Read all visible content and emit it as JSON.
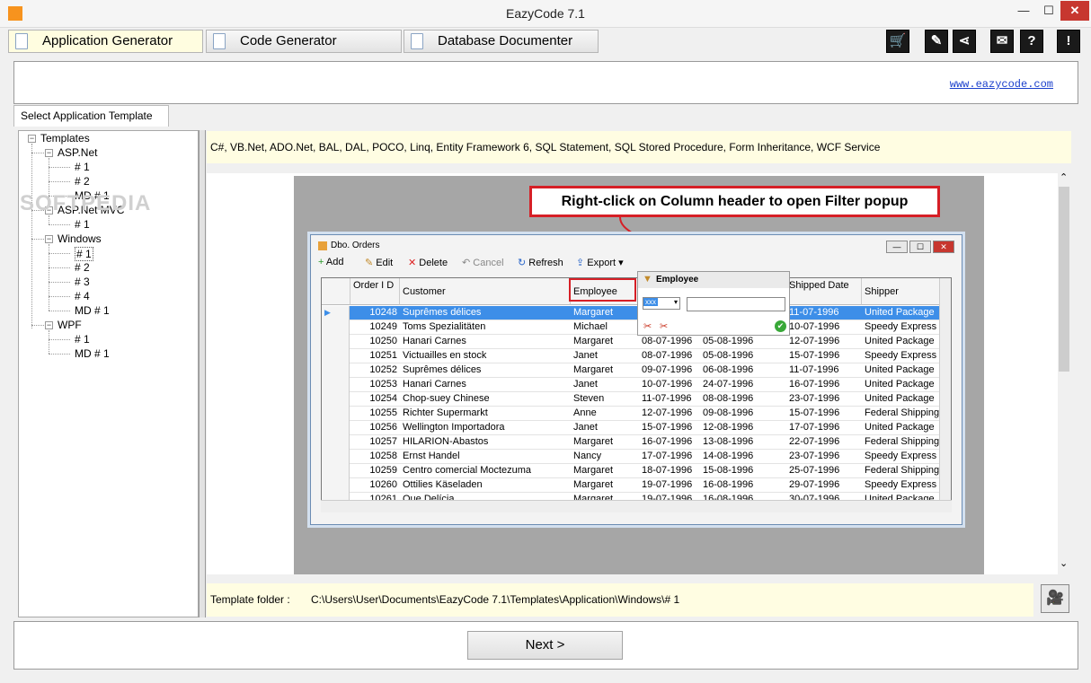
{
  "window": {
    "title": "EazyCode 7.1",
    "min": "—",
    "max": "☐",
    "close": "✕"
  },
  "tabs": [
    {
      "label": "Application Generator"
    },
    {
      "label": "Code Generator"
    },
    {
      "label": "Database Documenter"
    }
  ],
  "toolbar_icons": [
    "cart-icon",
    "edit-icon",
    "share-icon",
    "mail-icon",
    "help-icon",
    "alert-icon"
  ],
  "toolbar_glyphs": [
    "🛒",
    "✎",
    "⋖",
    "✉",
    "?",
    "!"
  ],
  "header": {
    "link": "www.eazycode.com"
  },
  "left_tab": {
    "label": "Select Application Template"
  },
  "tree": [
    {
      "label": "Templates",
      "expander": "−"
    },
    {
      "label": "ASP.Net",
      "expander": "−"
    },
    {
      "label": "# 1"
    },
    {
      "label": "# 2"
    },
    {
      "label": "MD # 1"
    },
    {
      "label": "ASP.Net MVC",
      "expander": "−"
    },
    {
      "label": "# 1"
    },
    {
      "label": "Windows",
      "expander": "−"
    },
    {
      "label": "# 1"
    },
    {
      "label": "# 2"
    },
    {
      "label": "# 3"
    },
    {
      "label": "# 4"
    },
    {
      "label": "MD # 1"
    },
    {
      "label": "WPF",
      "expander": "−"
    },
    {
      "label": "# 1"
    },
    {
      "label": "MD # 1"
    }
  ],
  "watermark": "SOFTPEDIA",
  "tech": "C#, VB.Net, ADO.Net, BAL, DAL, POCO, Linq, Entity Framework 6, SQL Statement, SQL Stored Procedure, Form Inheritance, WCF Service",
  "preview": {
    "callout": "Right-click on Column header to open Filter popup",
    "window_title": "Dbo. Orders",
    "tools": [
      "Add",
      "Edit",
      "Delete",
      "Cancel",
      "Refresh",
      "Export"
    ],
    "tool_icons": [
      "+",
      "✎",
      "✕",
      "↶",
      "↻",
      "⇪"
    ],
    "columns": [
      "Order I D",
      "Customer",
      "Employee",
      "",
      "",
      "Shipped Date",
      "Shipper"
    ],
    "rows": [
      [
        "10248",
        "Suprêmes délices",
        "Margaret",
        "",
        "",
        "11-07-1996",
        "United Package"
      ],
      [
        "10249",
        "Toms Spezialitäten",
        "Michael",
        "",
        "",
        "10-07-1996",
        "Speedy Express"
      ],
      [
        "10250",
        "Hanari Carnes",
        "Margaret",
        "08-07-1996",
        "05-08-1996",
        "12-07-1996",
        "United Package"
      ],
      [
        "10251",
        "Victuailles en stock",
        "Janet",
        "08-07-1996",
        "05-08-1996",
        "15-07-1996",
        "Speedy Express"
      ],
      [
        "10252",
        "Suprêmes délices",
        "Margaret",
        "09-07-1996",
        "06-08-1996",
        "11-07-1996",
        "United Package"
      ],
      [
        "10253",
        "Hanari Carnes",
        "Janet",
        "10-07-1996",
        "24-07-1996",
        "16-07-1996",
        "United Package"
      ],
      [
        "10254",
        "Chop-suey Chinese",
        "Steven",
        "11-07-1996",
        "08-08-1996",
        "23-07-1996",
        "United Package"
      ],
      [
        "10255",
        "Richter Supermarkt",
        "Anne",
        "12-07-1996",
        "09-08-1996",
        "15-07-1996",
        "Federal Shipping"
      ],
      [
        "10256",
        "Wellington Importadora",
        "Janet",
        "15-07-1996",
        "12-08-1996",
        "17-07-1996",
        "United Package"
      ],
      [
        "10257",
        "HILARION-Abastos",
        "Margaret",
        "16-07-1996",
        "13-08-1996",
        "22-07-1996",
        "Federal Shipping"
      ],
      [
        "10258",
        "Ernst Handel",
        "Nancy",
        "17-07-1996",
        "14-08-1996",
        "23-07-1996",
        "Speedy Express"
      ],
      [
        "10259",
        "Centro comercial Moctezuma",
        "Margaret",
        "18-07-1996",
        "15-08-1996",
        "25-07-1996",
        "Federal Shipping"
      ],
      [
        "10260",
        "Ottilies Käseladen",
        "Margaret",
        "19-07-1996",
        "16-08-1996",
        "29-07-1996",
        "Speedy Express"
      ],
      [
        "10261",
        "Que Delícia",
        "Margaret",
        "19-07-1996",
        "16-08-1996",
        "30-07-1996",
        "United Package"
      ]
    ],
    "filter": {
      "title": "Employee",
      "op": "xxx",
      "value": "",
      "ok": "✔"
    }
  },
  "folder": {
    "label": "Template folder :",
    "path": "C:\\Users\\User\\Documents\\EazyCode 7.1\\Templates\\Application\\Windows\\# 1"
  },
  "video_icon": "🎥",
  "next": {
    "label": "Next >"
  },
  "scroll": {
    "up": "⌃",
    "down": "⌄"
  }
}
